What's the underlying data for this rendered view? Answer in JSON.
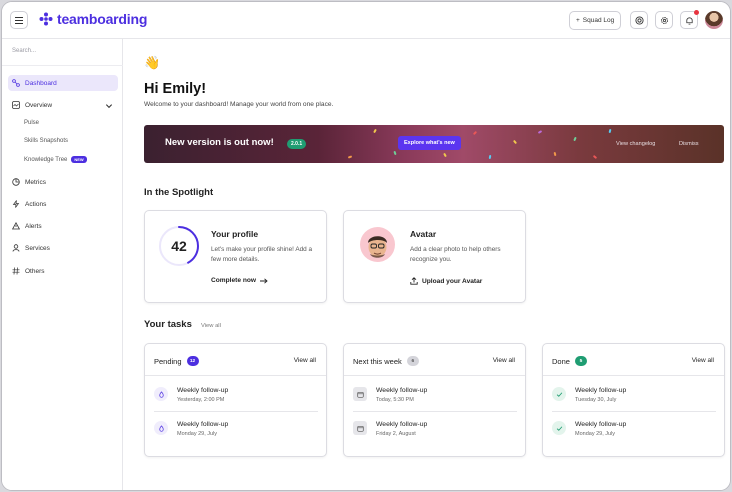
{
  "header": {
    "logo_text": "teamboarding",
    "squad_log_label": "Squad Log",
    "colors": {
      "brand": "#4c2fe0",
      "notification": "#e7343f"
    },
    "icons": [
      "menu-icon",
      "plus-icon",
      "support-icon",
      "gear-icon",
      "bell-icon"
    ]
  },
  "sidebar": {
    "search_placeholder": "Search...",
    "items": [
      {
        "label": "Dashboard",
        "icon": "dashboard-icon",
        "active": true
      },
      {
        "label": "Overview",
        "icon": "overview-icon",
        "expanded": true
      },
      {
        "label": "Metrics",
        "icon": "metrics-icon"
      },
      {
        "label": "Actions",
        "icon": "actions-icon"
      },
      {
        "label": "Alerts",
        "icon": "alert-icon"
      },
      {
        "label": "Services",
        "icon": "services-icon"
      },
      {
        "label": "Others",
        "icon": "hash-icon"
      }
    ],
    "sub_items": [
      {
        "label": "Pulse"
      },
      {
        "label": "Skills Snapshots"
      },
      {
        "label": "Knowledge Tree",
        "badge": "NEW"
      }
    ]
  },
  "main": {
    "wave_emoji": "👋",
    "greeting": "Hi Emily!",
    "welcome_text": "Welcome to your dashboard! Manage your world from one place.",
    "banner": {
      "title": "New version is out now!",
      "version": "2.0.1",
      "cta": "Explore what's new",
      "changelog": "View changelog",
      "dismiss": "Dismiss"
    },
    "spotlight_title": "In the Spotlight",
    "spotlight": [
      {
        "title": "Your profile",
        "text": "Let's make your profile shine! Add a few more details.",
        "action": "Complete now",
        "progress": 42
      },
      {
        "title": "Avatar",
        "text": "Add a clear photo to help others recognize you.",
        "action": "Upload your Avatar"
      }
    ],
    "tasks_title": "Your tasks",
    "tasks_view_all": "View all",
    "task_columns": [
      {
        "title": "Pending",
        "count": "12",
        "badge_color": "#4c2fe0",
        "link": "View all",
        "items": [
          {
            "name": "Weekly follow-up",
            "date": "Yesterday, 2:00 PM"
          },
          {
            "name": "Weekly follow-up",
            "date": "Monday 29, July"
          }
        ]
      },
      {
        "title": "Next this week",
        "count": "6",
        "badge_color": "#d4d4da",
        "link": "View all",
        "items": [
          {
            "name": "Weekly follow-up",
            "date": "Today, 5:30 PM"
          },
          {
            "name": "Weekly follow-up",
            "date": "Friday 2, August"
          }
        ]
      },
      {
        "title": "Done",
        "count": "5",
        "badge_color": "#1f9d72",
        "link": "View all",
        "items": [
          {
            "name": "Weekly follow-up",
            "date": "Tuesday 30, July"
          },
          {
            "name": "Weekly follow-up",
            "date": "Monday 29, July"
          }
        ]
      }
    ]
  }
}
